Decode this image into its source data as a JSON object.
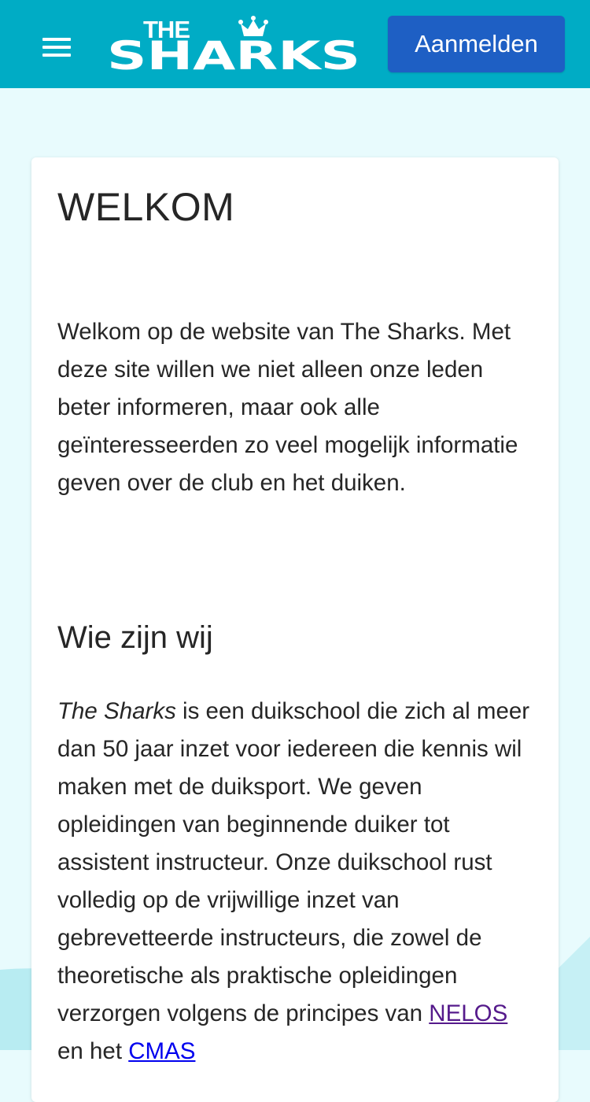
{
  "header": {
    "logo_text_top": "THE",
    "logo_text_main": "SHARKS",
    "login_label": "Aanmelden"
  },
  "colors": {
    "header_bg": "#00acc5",
    "button_bg": "#1e5fc4",
    "page_bg": "#e8fbfd"
  },
  "main": {
    "title": "WELKOM",
    "intro": "Welkom op de website van The Sharks. Met deze site willen we niet alleen onze leden beter informeren, maar ook alle geïnteresseerden zo veel mogelijk informatie geven over de club en het duiken.",
    "section_title": "Wie zijn wij",
    "about_club_name": "The Sharks",
    "about_text": " is een duikschool die zich al meer dan 50 jaar inzet voor iedereen die kennis wil maken met de duiksport. We geven opleidingen van beginnende duiker tot assistent instructeur. Onze duikschool rust volledig op de vrijwillige inzet van gebrevetteerde instructeurs, die zowel de theoretische als praktische opleidingen verzorgen volgens de principes van ",
    "link_nelos": "NELOS",
    "about_conj": " en het ",
    "link_cmas": "CMAS"
  },
  "icons": {
    "menu": "hamburger-menu-icon",
    "crown": "crown-icon"
  }
}
